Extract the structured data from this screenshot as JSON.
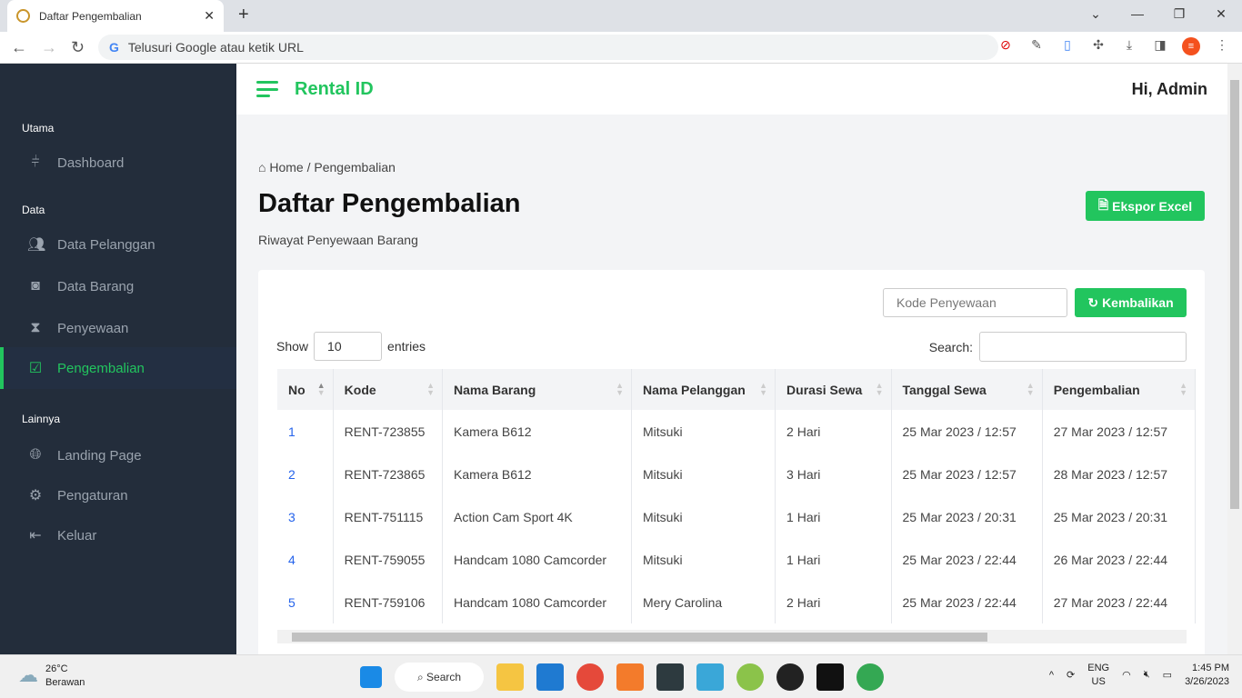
{
  "browser": {
    "tab_title": "Daftar Pengembalian",
    "omnibox_placeholder": "Telusuri Google atau ketik URL"
  },
  "app": {
    "brand": "Rental ID",
    "greeting": "Hi, Admin"
  },
  "sidebar": {
    "sections": [
      {
        "label": "Utama",
        "items": [
          {
            "label": "Dashboard",
            "icon": "sliders-icon"
          }
        ]
      },
      {
        "label": "Data",
        "items": [
          {
            "label": "Data Pelanggan",
            "icon": "users-icon"
          },
          {
            "label": "Data Barang",
            "icon": "camera-icon"
          },
          {
            "label": "Penyewaan",
            "icon": "hourglass-icon"
          },
          {
            "label": "Pengembalian",
            "icon": "check-square-icon",
            "active": true
          }
        ]
      },
      {
        "label": "Lainnya",
        "items": [
          {
            "label": "Landing Page",
            "icon": "globe-icon"
          },
          {
            "label": "Pengaturan",
            "icon": "gear-icon"
          },
          {
            "label": "Keluar",
            "icon": "logout-icon"
          }
        ]
      }
    ]
  },
  "page": {
    "breadcrumb_home": "Home",
    "breadcrumb_sep": "/",
    "breadcrumb_current": "Pengembalian",
    "title": "Daftar Pengembalian",
    "subtitle": "Riwayat Penyewaan Barang",
    "export_label": "Ekspor Excel"
  },
  "form": {
    "kode_placeholder": "Kode Penyewaan",
    "kembalikan_label": "Kembalikan"
  },
  "table_controls": {
    "show": "Show",
    "entries_value": "10",
    "entries": "entries",
    "search": "Search:"
  },
  "table": {
    "columns": [
      "No",
      "Kode",
      "Nama Barang",
      "Nama Pelanggan",
      "Durasi Sewa",
      "Tanggal Sewa",
      "Pengembalian"
    ],
    "rows": [
      [
        "1",
        "RENT-723855",
        "Kamera B612",
        "Mitsuki",
        "2 Hari",
        "25 Mar 2023 / 12:57",
        "27 Mar 2023 / 12:57"
      ],
      [
        "2",
        "RENT-723865",
        "Kamera B612",
        "Mitsuki",
        "3 Hari",
        "25 Mar 2023 / 12:57",
        "28 Mar 2023 / 12:57"
      ],
      [
        "3",
        "RENT-751115",
        "Action Cam Sport 4K",
        "Mitsuki",
        "1 Hari",
        "25 Mar 2023 / 20:31",
        "25 Mar 2023 / 20:31"
      ],
      [
        "4",
        "RENT-759055",
        "Handcam 1080 Camcorder",
        "Mitsuki",
        "1 Hari",
        "25 Mar 2023 / 22:44",
        "26 Mar 2023 / 22:44"
      ],
      [
        "5",
        "RENT-759106",
        "Handcam 1080 Camcorder",
        "Mery Carolina",
        "2 Hari",
        "25 Mar 2023 / 22:44",
        "27 Mar 2023 / 22:44"
      ]
    ]
  },
  "taskbar": {
    "temp": "26°C",
    "weather": "Berawan",
    "search": "Search",
    "lang1": "ENG",
    "lang2": "US",
    "time": "1:45 PM",
    "date": "3/26/2023"
  },
  "colors": {
    "accent": "#22c55e",
    "sidebar": "#232d3b"
  }
}
